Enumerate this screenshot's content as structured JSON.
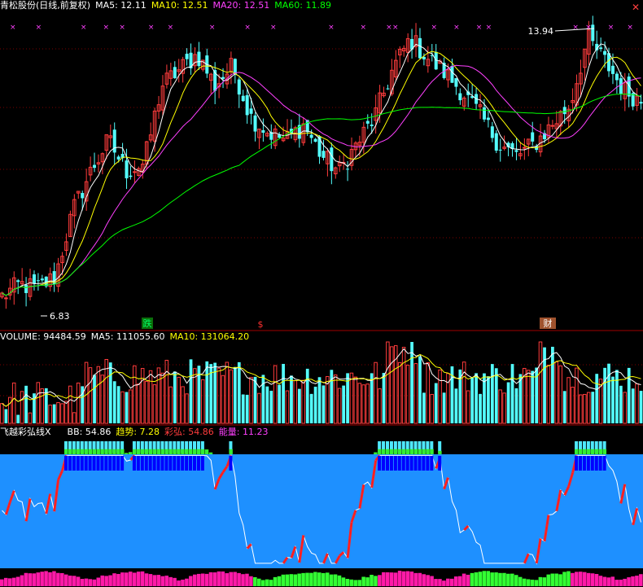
{
  "header": {
    "stock_title": "青松股份(日线,前复权)",
    "ma5": "MA5: 12.11",
    "ma10": "MA10: 12.51",
    "ma20": "MA20: 12.51",
    "ma60": "MA60: 11.89"
  },
  "volume_header": {
    "volume": "VOLUME: 94484.59",
    "ma5": "MA5: 111055.60",
    "ma10": "MA10: 131064.20"
  },
  "indicator_header": {
    "name": "飞越彩弘线X",
    "bb": "BB: 54.86",
    "trend": "趋势: 7.28",
    "caihong": "彩弘: 54.86",
    "energy": "能量: 11.23"
  },
  "annotations": {
    "high_price": "13.94",
    "low_price": "6.83",
    "marker_die": "跌",
    "marker_s": "$",
    "marker_cai": "财"
  },
  "colors": {
    "up_candle": "#ff3c3c",
    "down_candle": "#54ffff",
    "ma5": "#ffffff",
    "ma10": "#ffff00",
    "ma20": "#ff40ff",
    "ma60": "#00ff00",
    "indicator_bg": "#1e90ff",
    "panel_divider": "#a00000",
    "grid": "#7a0000"
  },
  "chart_data": [
    {
      "type": "candlestick",
      "title": "青松股份(日线,前复权)",
      "series": [
        {
          "name": "MA5",
          "value": 12.11
        },
        {
          "name": "MA10",
          "value": 12.51
        },
        {
          "name": "MA20",
          "value": 12.51
        },
        {
          "name": "MA60",
          "value": 11.89
        }
      ],
      "annotations": {
        "highest": 13.94,
        "lowest": 6.83
      },
      "ylim": [
        6.5,
        14.3
      ],
      "close_path": [
        7.0,
        7.3,
        7.2,
        7.5,
        9.2,
        10.2,
        11.0,
        10.2,
        10.4,
        12.4,
        12.8,
        13.2,
        12.4,
        12.9,
        11.6,
        11.2,
        11.0,
        11.4,
        10.6,
        10.2,
        10.9,
        11.6,
        12.8,
        13.6,
        13.1,
        12.7,
        12.2,
        11.6,
        10.9,
        10.6,
        10.9,
        11.4,
        11.9,
        13.6,
        13.0,
        12.3,
        12.0
      ]
    },
    {
      "type": "bar",
      "title": "VOLUME",
      "series": [
        {
          "name": "VOLUME",
          "value": 94484.59
        },
        {
          "name": "MA5",
          "value": 111055.6
        },
        {
          "name": "MA10",
          "value": 131064.2
        }
      ]
    },
    {
      "type": "line",
      "title": "飞越彩弘线X",
      "series": [
        {
          "name": "BB",
          "value": 54.86
        },
        {
          "name": "趋势",
          "value": 7.28
        },
        {
          "name": "彩弘",
          "value": 54.86
        },
        {
          "name": "能量",
          "value": 11.23
        }
      ]
    }
  ]
}
